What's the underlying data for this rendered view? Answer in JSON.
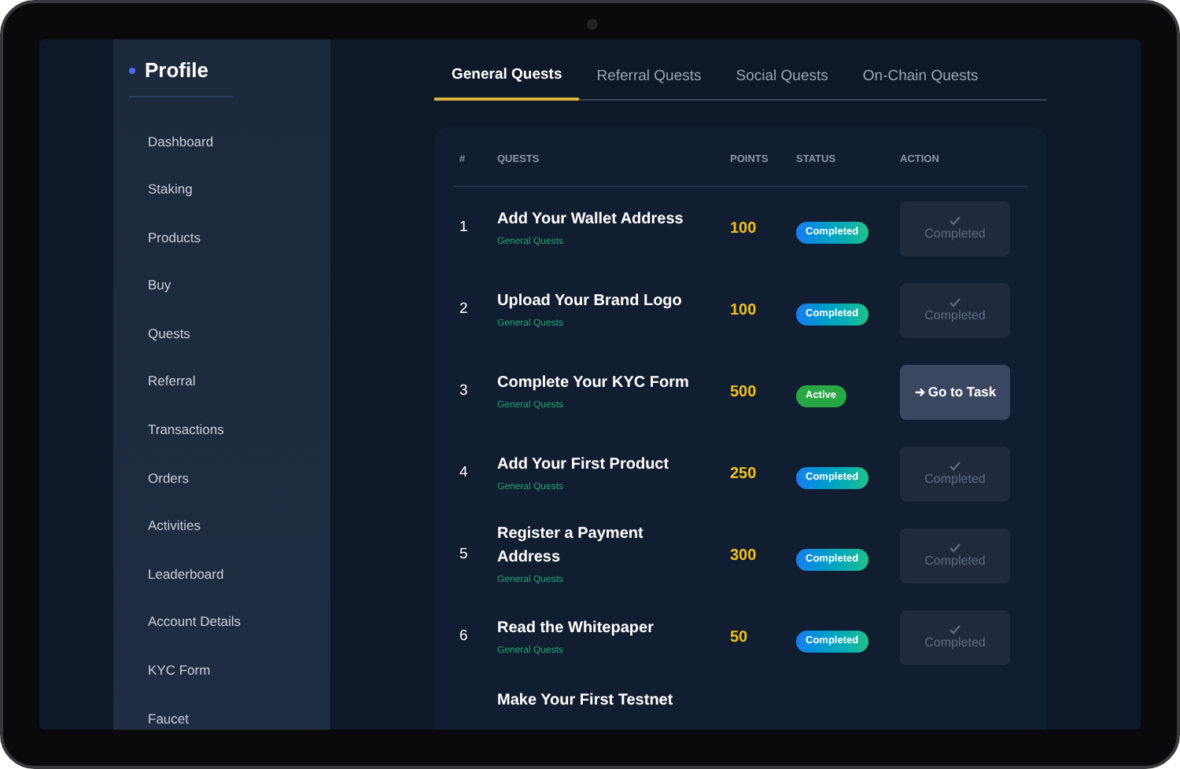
{
  "sidebar": {
    "title": "Profile",
    "items": [
      {
        "label": "Dashboard"
      },
      {
        "label": "Staking"
      },
      {
        "label": "Products"
      },
      {
        "label": "Buy"
      },
      {
        "label": "Quests"
      },
      {
        "label": "Referral"
      },
      {
        "label": "Transactions"
      },
      {
        "label": "Orders"
      },
      {
        "label": "Activities"
      },
      {
        "label": "Leaderboard"
      },
      {
        "label": "Account Details"
      },
      {
        "label": "KYC Form"
      },
      {
        "label": "Faucet"
      }
    ]
  },
  "tabs": [
    {
      "label": "General Quests",
      "selected": true
    },
    {
      "label": "Referral Quests",
      "selected": false
    },
    {
      "label": "Social Quests",
      "selected": false
    },
    {
      "label": "On-Chain Quests",
      "selected": false
    }
  ],
  "table": {
    "columns": [
      "#",
      "QUESTS",
      "POINTS",
      "STATUS",
      "ACTION"
    ],
    "rows": [
      {
        "number": "1",
        "title": "Add Your Wallet Address",
        "category": "General Quests",
        "points": "100",
        "status": {
          "kind": "completed",
          "label": "Completed"
        },
        "action": {
          "kind": "done",
          "label": "Completed"
        }
      },
      {
        "number": "2",
        "title": "Upload Your Brand Logo",
        "category": "General Quests",
        "points": "100",
        "status": {
          "kind": "completed",
          "label": "Completed"
        },
        "action": {
          "kind": "done",
          "label": "Completed"
        }
      },
      {
        "number": "3",
        "title": "Complete Your KYC Form",
        "category": "General Quests",
        "points": "500",
        "status": {
          "kind": "active",
          "label": "Active"
        },
        "action": {
          "kind": "go",
          "label": "Go to Task"
        }
      },
      {
        "number": "4",
        "title": "Add Your First Product",
        "category": "General Quests",
        "points": "250",
        "status": {
          "kind": "completed",
          "label": "Completed"
        },
        "action": {
          "kind": "done",
          "label": "Completed"
        }
      },
      {
        "number": "5",
        "title": "Register a Payment Address",
        "category": "General Quests",
        "points": "300",
        "status": {
          "kind": "completed",
          "label": "Completed"
        },
        "action": {
          "kind": "done",
          "label": "Completed"
        }
      },
      {
        "number": "6",
        "title": "Read the Whitepaper",
        "category": "General Quests",
        "points": "50",
        "status": {
          "kind": "completed",
          "label": "Completed"
        },
        "action": {
          "kind": "done",
          "label": "Completed"
        }
      },
      {
        "title": "Make Your First Testnet"
      }
    ]
  }
}
